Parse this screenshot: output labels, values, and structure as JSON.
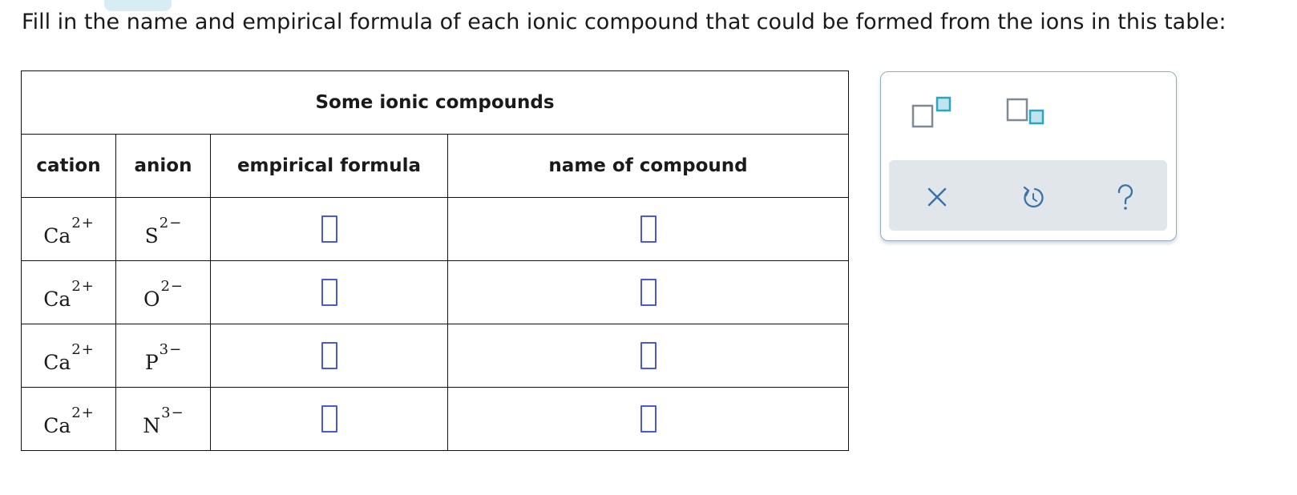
{
  "instruction": "Fill in the name and empirical formula of each ionic compound that could be formed from the ions in this table:",
  "table": {
    "caption": "Some ionic compounds",
    "headers": {
      "cation": "cation",
      "anion": "anion",
      "formula": "empirical formula",
      "name": "name of compound"
    },
    "rows": [
      {
        "cation_symbol": "Ca",
        "cation_charge": "2+",
        "anion_symbol": "S",
        "anion_charge": "2−",
        "formula": "",
        "name": ""
      },
      {
        "cation_symbol": "Ca",
        "cation_charge": "2+",
        "anion_symbol": "O",
        "anion_charge": "2−",
        "formula": "",
        "name": ""
      },
      {
        "cation_symbol": "Ca",
        "cation_charge": "2+",
        "anion_symbol": "P",
        "anion_charge": "3−",
        "formula": "",
        "name": ""
      },
      {
        "cation_symbol": "Ca",
        "cation_charge": "2+",
        "anion_symbol": "N",
        "anion_charge": "3−",
        "formula": "",
        "name": ""
      }
    ]
  },
  "palette": {
    "tools": [
      "superscript-icon",
      "subscript-icon"
    ],
    "actions": [
      "clear-icon",
      "undo-icon",
      "help-icon"
    ],
    "colors": {
      "accent": "#2aa6c4",
      "icon_gray": "#7d8a94",
      "action_icon": "#3a73a8",
      "input_border": "#4a57e3"
    }
  }
}
